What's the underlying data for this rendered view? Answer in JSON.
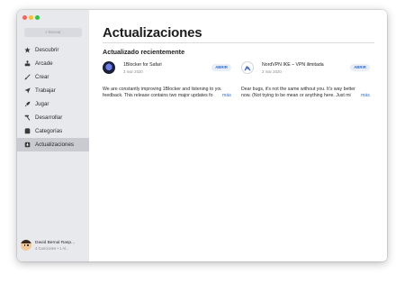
{
  "sidebar": {
    "search_placeholder": "Buscar",
    "items": [
      {
        "label": "Descubrir",
        "icon": "star-icon"
      },
      {
        "label": "Arcade",
        "icon": "arcade-icon"
      },
      {
        "label": "Crear",
        "icon": "brush-icon"
      },
      {
        "label": "Trabajar",
        "icon": "paperplane-icon"
      },
      {
        "label": "Jugar",
        "icon": "rocket-icon"
      },
      {
        "label": "Desarrollar",
        "icon": "hammer-icon"
      },
      {
        "label": "Categorías",
        "icon": "categories-icon"
      },
      {
        "label": "Actualizaciones",
        "icon": "updates-icon",
        "active": true
      }
    ],
    "user": {
      "name": "David Bernal Rasp...",
      "sub": "4 Canciones • 1 Al..."
    }
  },
  "main": {
    "title": "Actualizaciones",
    "section_title": "Actualizado recientemente",
    "cards": [
      {
        "name": "1Blocker for Safari",
        "date": "3 mar 2020",
        "button": "ABRIR",
        "desc_line1": "We are constantly improving 1Blocker and listening to your",
        "desc_line2": "feedback. This release contains two major updates fo",
        "more": "más"
      },
      {
        "name": "NordVPN IKE – VPN ilimitada",
        "date": "2 mar 2020",
        "button": "ABRIR",
        "desc_line1": "Dear bugs, it's not the same without you. It's way better",
        "desc_line2": "now. (Not trying to be mean or anything here. Just mi",
        "more": "más"
      }
    ]
  },
  "colors": {
    "accent": "#2f6fd8",
    "sidebar_bg": "#e7e9ed",
    "active_bg": "#c9cbd0"
  }
}
